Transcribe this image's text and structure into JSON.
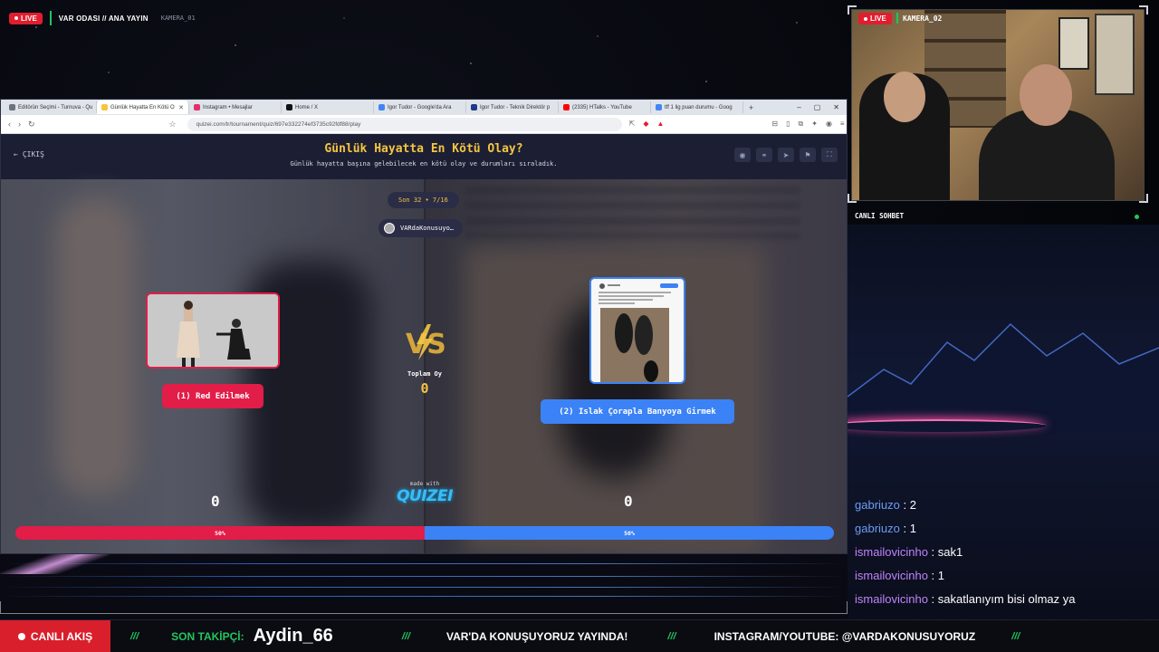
{
  "overlay": {
    "live_label": "LIVE",
    "title": "VAR ODASI // ANA YAYIN",
    "camera1_label": "KAMERA_01",
    "camera2_label": "KAMERA_02"
  },
  "browser": {
    "tabs": [
      {
        "label": "Editörün Seçimi - Turnuva - Qu",
        "icon_color": "#6b7280"
      },
      {
        "label": "Günlük Hayatta En Kötü O",
        "icon_color": "#f5c542",
        "active": true
      },
      {
        "label": "Instagram • Mesajlar",
        "icon_color": "#e1306c"
      },
      {
        "label": "Home / X",
        "icon_color": "#111111"
      },
      {
        "label": "Igor Tudor - Google'da Ara",
        "icon_color": "#4285f4"
      },
      {
        "label": "Igor Tudor - Teknik Direktör p",
        "icon_color": "#1e3a8a"
      },
      {
        "label": "(2335) HTalks - YouTube",
        "icon_color": "#ff0000"
      },
      {
        "label": "tff 1 lig puan durumu - Goog",
        "icon_color": "#4285f4"
      }
    ],
    "url": "quizei.com/tr/tournament/quiz/697e332274ef3735c92fdf88/play"
  },
  "quiz": {
    "exit_label": "ÇIKIŞ",
    "title": "Günlük Hayatta En Kötü Olay?",
    "subtitle": "Günlük hayatta başına gelebilecek en kötü olay ve durumları sıraladık.",
    "round": "Son 32 • 7/16",
    "user": "VARdaKonusuyo…",
    "vs_label": "VS",
    "total_label": "Toplam Oy",
    "total_value": "0",
    "option_left": "(1) Red Edilmek",
    "option_right": "(2) Islak Çorapla Banyoya Girmek",
    "votes_left": "0",
    "votes_right": "0",
    "percent_left": "50%",
    "percent_right": "50%",
    "share_left": 0.5,
    "made_with": "made with",
    "brand": "QUIZEI"
  },
  "chat": {
    "header": "CANLI SOHBET",
    "messages": [
      {
        "user": "gabriuzo",
        "text": ": 2",
        "color": "#6a9cf3"
      },
      {
        "user": "gabriuzo",
        "text": ": 1",
        "color": "#6a9cf3"
      },
      {
        "user": "ismailovicinho",
        "text": ": sak1",
        "color": "#c084fc"
      },
      {
        "user": "ismailovicinho",
        "text": ": 1",
        "color": "#c084fc"
      },
      {
        "user": "ismailovicinho",
        "text": ": sakatlanıyım bisi olmaz ya",
        "color": "#c084fc"
      }
    ]
  },
  "ticker": {
    "live": "CANLI AKIŞ",
    "slash": "///",
    "follower_label": "SON TAKİPÇİ:",
    "follower_name": "Aydin_66",
    "msg1": "VAR'DA KONUŞUYORUZ YAYINDA!",
    "msg2": "INSTAGRAM/YOUTUBE: @VARDAKONUSUYORUZ"
  }
}
